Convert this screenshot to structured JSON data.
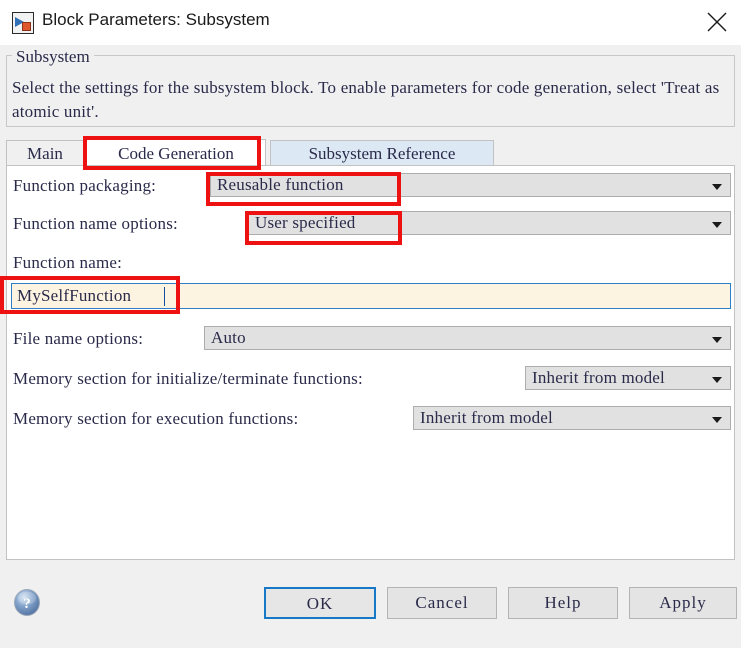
{
  "window": {
    "title": "Block Parameters: Subsystem",
    "icon": "simulink-subsystem-block-icon",
    "close_label": "close-icon"
  },
  "group": {
    "legend": "Subsystem",
    "description": "Select the settings for the subsystem block. To enable parameters for code generation, select 'Treat as atomic unit'."
  },
  "tabs": [
    {
      "label": "Main",
      "state": "normal"
    },
    {
      "label": "Code Generation",
      "state": "selected"
    },
    {
      "label": "Subsystem Reference",
      "state": "hovered"
    }
  ],
  "fields": {
    "function_packaging": {
      "label": "Function packaging:",
      "value": "Reusable function"
    },
    "function_name_options": {
      "label": "Function name options:",
      "value": "User specified"
    },
    "function_name": {
      "label": "Function name:",
      "value": "MySelfFunction"
    },
    "file_name_options": {
      "label": "File name options:",
      "value": "Auto"
    },
    "memory_section_init": {
      "label": "Memory section for initialize/terminate functions:",
      "value": "Inherit from model"
    },
    "memory_section_exec": {
      "label": "Memory section for execution functions:",
      "value": "Inherit from model"
    }
  },
  "buttons": {
    "help_icon": "help-question-icon",
    "ok": "OK",
    "cancel": "Cancel",
    "help": "Help",
    "apply": "Apply"
  },
  "colors": {
    "annotation": "#ee1111",
    "focus_border": "#1878c8",
    "input_background": "#fdf3e1",
    "tab_hover": "#dce9f5",
    "combo_background": "#e1e1e1",
    "window_background": "#f0f0f0"
  },
  "annotations": [
    {
      "target": "tab-code-generation"
    },
    {
      "target": "function-packaging-value"
    },
    {
      "target": "function-name-options-value"
    },
    {
      "target": "function-name-input"
    }
  ]
}
